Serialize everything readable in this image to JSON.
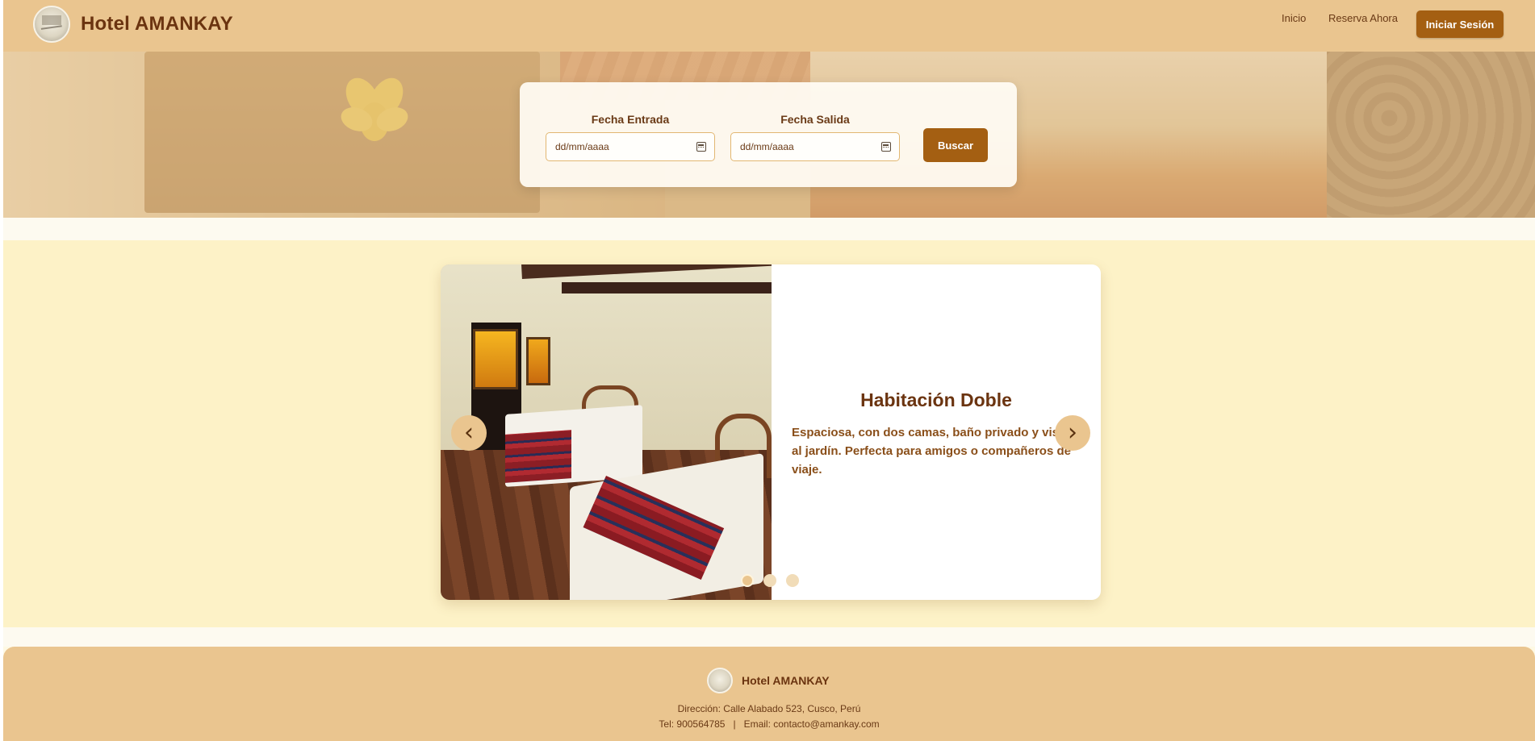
{
  "nav": {
    "brand": "Hotel AMANKAY",
    "links": [
      "Inicio",
      "Reserva Ahora"
    ],
    "login_label": "Iniciar Sesión"
  },
  "search": {
    "checkin_label": "Fecha Entrada",
    "checkout_label": "Fecha Salida",
    "checkin_placeholder": "dd/mm/aaaa",
    "checkout_placeholder": "dd/mm/aaaa",
    "button_label": "Buscar"
  },
  "carousel": {
    "title": "Habitación Doble",
    "description": "Espaciosa, con dos camas, baño privado y vista al jardín. Perfecta para amigos o compañeros de viaje.",
    "prev_icon": "‹",
    "next_icon": "›",
    "slides": 3,
    "active_slide": 1
  },
  "footer": {
    "brand": "Hotel AMANKAY",
    "address": "Dirección: Calle Alabado 523, Cusco, Perú",
    "contact": "Tel: 900564785   |   Email: contacto@amankay.com"
  },
  "colors": {
    "header": "#eac58f",
    "accent_button": "#a45f12",
    "section_bg": "#fdf2c7",
    "text_brown": "#6b3410"
  }
}
